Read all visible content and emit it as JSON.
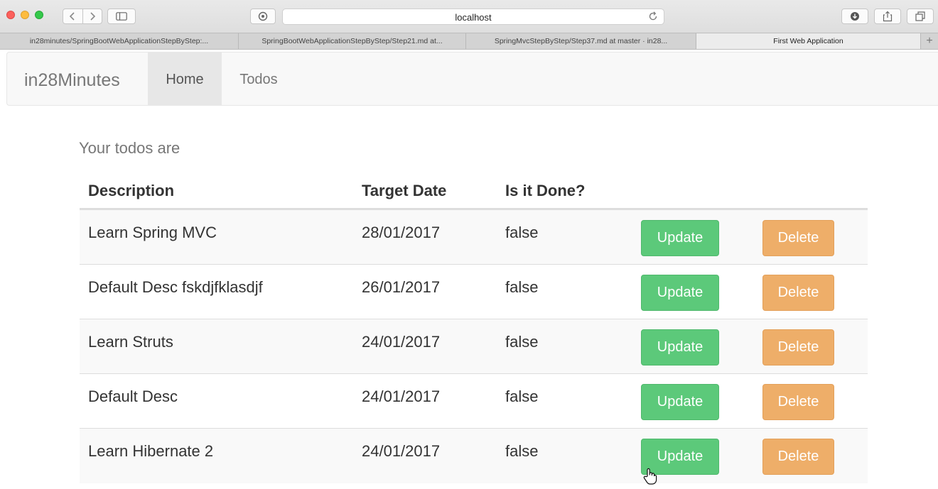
{
  "browser": {
    "url": "localhost",
    "tabs": [
      {
        "label": "in28minutes/SpringBootWebApplicationStepByStep:..."
      },
      {
        "label": "SpringBootWebApplicationStepByStep/Step21.md at..."
      },
      {
        "label": "SpringMvcStepByStep/Step37.md at master · in28..."
      },
      {
        "label": "First Web Application"
      }
    ],
    "new_tab": "+"
  },
  "navbar": {
    "brand": "in28Minutes",
    "links": [
      {
        "label": "Home"
      },
      {
        "label": "Todos"
      }
    ]
  },
  "todos": {
    "heading": "Your todos are",
    "columns": [
      "Description",
      "Target Date",
      "Is it Done?"
    ],
    "rows": [
      {
        "description": "Learn Spring MVC",
        "target_date": "28/01/2017",
        "done": "false"
      },
      {
        "description": "Default Desc fskdjfklasdjf",
        "target_date": "26/01/2017",
        "done": "false"
      },
      {
        "description": "Learn Struts",
        "target_date": "24/01/2017",
        "done": "false"
      },
      {
        "description": "Default Desc",
        "target_date": "24/01/2017",
        "done": "false"
      },
      {
        "description": "Learn Hibernate 2",
        "target_date": "24/01/2017",
        "done": "false"
      }
    ],
    "update_label": "Update",
    "delete_label": "Delete"
  },
  "colors": {
    "update": "#5cc97a",
    "delete": "#eeae69"
  },
  "icons": [
    "back-icon",
    "forward-icon",
    "sidebar-icon",
    "privacy-icon",
    "reload-icon",
    "download-icon",
    "share-icon",
    "tabs-icon",
    "hand-cursor-icon"
  ]
}
